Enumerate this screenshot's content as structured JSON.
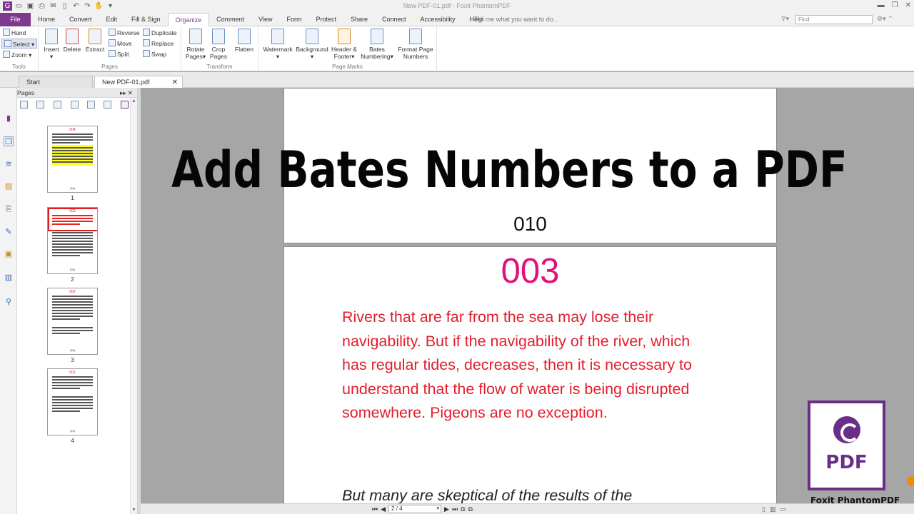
{
  "app": {
    "title": "New PDF-01.pdf - Foxit PhantomPDF"
  },
  "menu": {
    "file": "File",
    "tabs": [
      "Home",
      "Convert",
      "Edit",
      "Fill & Sign",
      "Organize",
      "Comment",
      "View",
      "Form",
      "Protect",
      "Share",
      "Connect",
      "Accessibility",
      "Help"
    ],
    "active_tab": "Organize",
    "tell_me": "Tell me what you want to do...",
    "find_placeholder": "Find"
  },
  "ribbon": {
    "tools": {
      "hand": "Hand",
      "select": "Select",
      "zoom": "Zoom",
      "label": "Tools"
    },
    "pages": {
      "insert": "Insert",
      "delete": "Delete",
      "extract": "Extract",
      "reverse": "Reverse",
      "move": "Move",
      "split": "Split",
      "duplicate": "Duplicate",
      "replace": "Replace",
      "swap": "Swap",
      "label": "Pages"
    },
    "transform": {
      "rotate_1": "Rotate",
      "rotate_2": "Pages",
      "crop_1": "Crop",
      "crop_2": "Pages",
      "flatten": "Flatten",
      "label": "Transform"
    },
    "page_marks": {
      "watermark": "Watermark",
      "background": "Background",
      "header_1": "Header &",
      "header_2": "Footer",
      "bates_1": "Bates",
      "bates_2": "Numbering",
      "format_1": "Format Page",
      "format_2": "Numbers",
      "label": "Page Marks"
    }
  },
  "doc_tabs": {
    "start": "Start",
    "current": "New PDF-01.pdf"
  },
  "pages_panel": {
    "title": "Pages",
    "thumbs": [
      {
        "label": "1",
        "header": "004"
      },
      {
        "label": "2",
        "header": "003"
      },
      {
        "label": "3",
        "header": "002"
      },
      {
        "label": "4",
        "header": "001"
      }
    ]
  },
  "document": {
    "page1_bates": "010",
    "page2_header": "003",
    "page2_body": "Rivers that are far from the sea may lose their navigability. But if the navigability of the river, which has regular tides, decreases, then it is necessary to understand that the flow of water is being disrupted somewhere. Pigeons are no exception.",
    "page2_next": "But many are skeptical of the results of the"
  },
  "overlay": {
    "banner": "Add Bates Numbers to a PDF",
    "logo_text": "PDF",
    "logo_caption": "Foxit PhantomPDF"
  },
  "statusbar": {
    "page_box": "2 / 4"
  },
  "colors": {
    "brand": "#7d3a8c",
    "bates_header": "#e2117a",
    "body_text": "#e31e2c"
  }
}
